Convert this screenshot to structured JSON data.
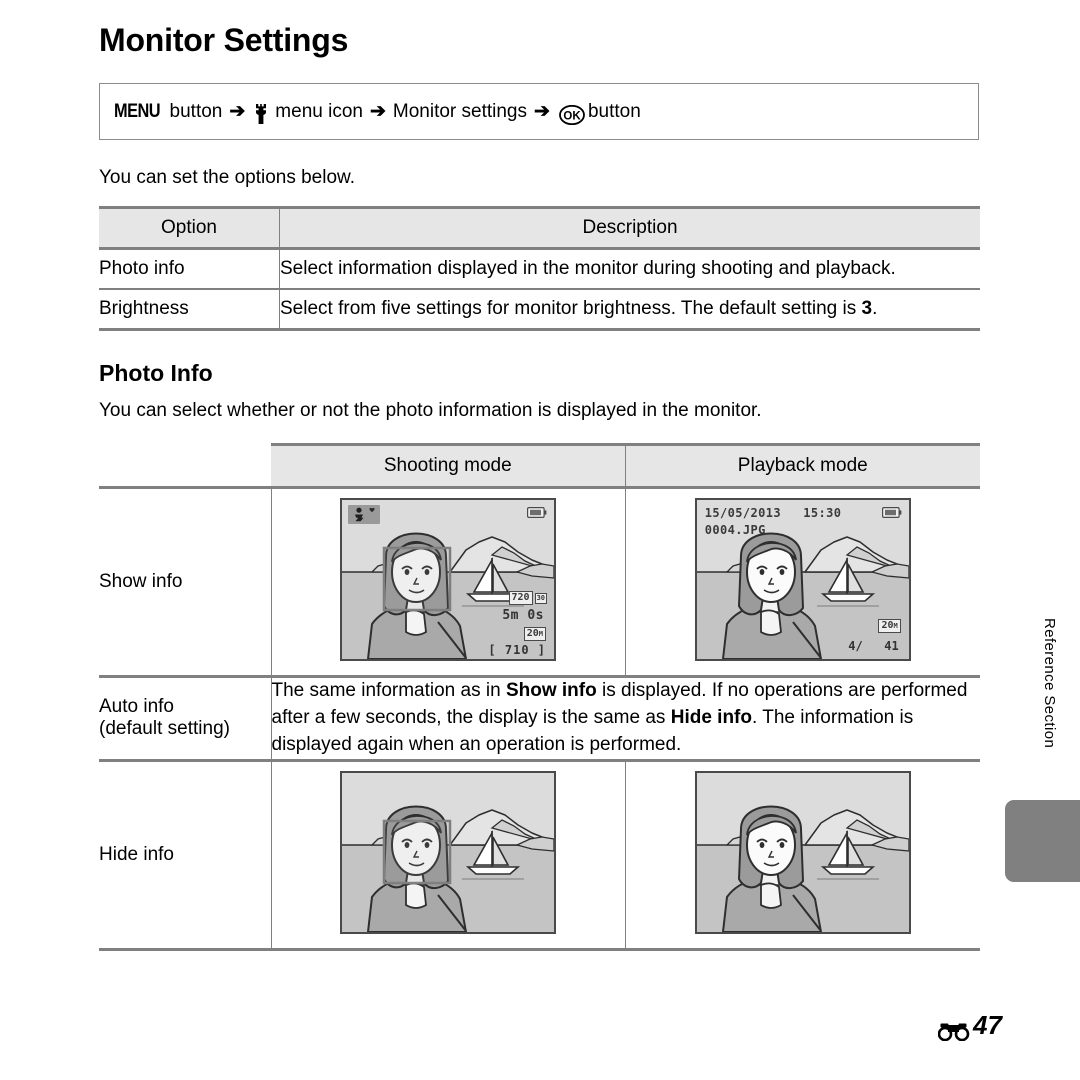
{
  "page": {
    "title": "Monitor Settings",
    "page_number": "47",
    "page_number_prefix_icon": "reference-section-glyph",
    "side_tab_label": "Reference Section"
  },
  "nav_path": {
    "menu_button": "MENU",
    "button_word": "button",
    "arrow": "➔",
    "setup_icon": "wrench-icon",
    "menu_icon_label": "menu icon",
    "item": "Monitor settings",
    "ok_icon": "ok-button-icon",
    "ok_button_word": "button"
  },
  "intro": "You can set the options below.",
  "options_table": {
    "headers": [
      "Option",
      "Description"
    ],
    "rows": [
      {
        "option": "Photo info",
        "description": "Select information displayed in the monitor during shooting and playback."
      },
      {
        "option": "Brightness",
        "description_pre": "Select from five settings for monitor brightness. The default setting is ",
        "description_bold": "3",
        "description_post": "."
      }
    ]
  },
  "photo_info": {
    "heading": "Photo Info",
    "intro": "You can select whether or not the photo information is displayed in the monitor.",
    "headers": [
      "Shooting mode",
      "Playback mode"
    ],
    "rows": [
      {
        "label": "Show info",
        "label_sub": "",
        "type": "images"
      },
      {
        "label": "Auto info",
        "label_sub": "(default setting)",
        "type": "text",
        "text_part1": "The same information as in ",
        "text_bold1": "Show info",
        "text_part2": " is displayed. If no operations are performed after a few seconds, the display is the same as ",
        "text_bold2": "Hide info",
        "text_part3": ". The information is displayed again when an operation is performed."
      },
      {
        "label": "Hide info",
        "label_sub": "",
        "type": "images"
      }
    ]
  },
  "screens": {
    "shooting_show_info": {
      "scene_mode_icon": "portrait-scene-icon",
      "battery_icon": "battery-icon",
      "movie_size": "720",
      "frame_rate": "30",
      "record_time": "5m 0s",
      "image_size": "20",
      "image_size_suffix": "M",
      "shots_remaining": "[ 710 ]",
      "af_frame": true
    },
    "playback_show_info": {
      "date": "15/05/2013",
      "time": "15:30",
      "filename": "0004.JPG",
      "battery_icon": "battery-icon",
      "frame_current": "4/",
      "frame_total": "41",
      "image_size": "20",
      "image_size_suffix": "M"
    },
    "shooting_hide_info": {
      "af_frame": true
    },
    "playback_hide_info": {
      "af_frame": false
    }
  },
  "colors": {
    "rule": "#808080",
    "header_fill": "#e6e6e6",
    "screen_sky": "#d6d6d6",
    "screen_sea": "#c2c2c2",
    "screen_outline": "#3a3a3a",
    "tab_gray": "#808080"
  }
}
